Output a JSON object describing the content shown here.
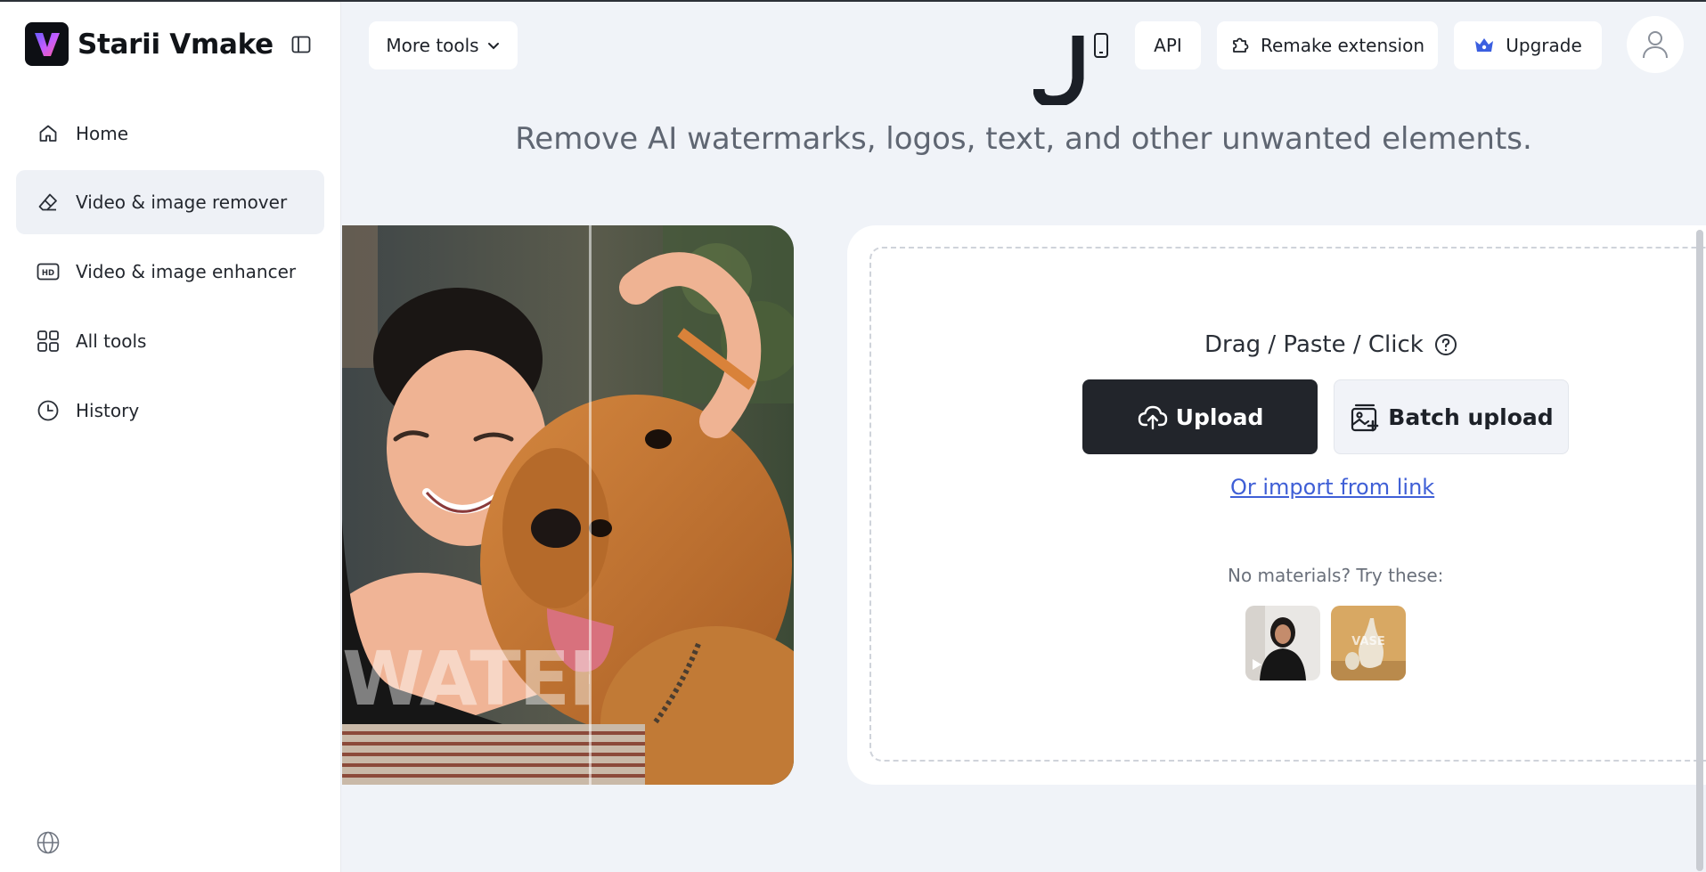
{
  "brand": {
    "name": "Starii Vmake"
  },
  "sidebar": {
    "items": [
      {
        "label": "Home",
        "icon": "home-icon",
        "active": false
      },
      {
        "label": "Video & image remover",
        "icon": "eraser-icon",
        "active": true
      },
      {
        "label": "Video & image enhancer",
        "icon": "hd-icon",
        "active": false
      },
      {
        "label": "All tools",
        "icon": "grid-icon",
        "active": false
      },
      {
        "label": "History",
        "icon": "clock-icon",
        "active": false
      }
    ],
    "footer_icon": "globe-icon"
  },
  "topbar": {
    "more_tools": "More tools",
    "api": "API",
    "extension": "Remake extension",
    "upgrade": "Upgrade"
  },
  "main": {
    "subtitle": "Remove AI watermarks, logos, text, and other unwanted elements.",
    "demo_watermark": "WATERMARK",
    "upload": {
      "instruction": "Drag / Paste / Click",
      "upload_label": "Upload",
      "batch_label": "Batch upload",
      "import_link": "Or import from link",
      "samples_label": "No materials? Try these:",
      "sample2_overlay": "VASE"
    }
  },
  "colors": {
    "accent_dark": "#22252b",
    "link": "#3f5fd6",
    "upgrade_icon": "#3b5fe0",
    "background": "#f0f3f8"
  }
}
